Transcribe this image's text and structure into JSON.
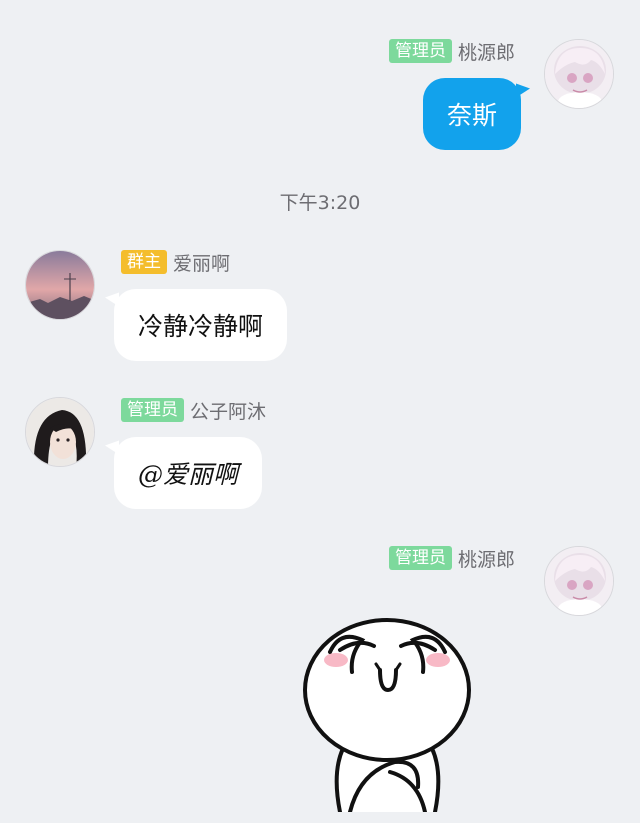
{
  "colors": {
    "background": "#eef0f3",
    "outgoing_bubble": "#12a2ec",
    "incoming_bubble": "#ffffff",
    "admin_badge": "#7dd99c",
    "owner_badge": "#f4bd2c"
  },
  "messages": [
    {
      "direction": "outgoing",
      "badge": "管理员",
      "sender": "桃源郎",
      "text": "奈斯",
      "avatar_icon": "anime-girl-avatar-icon"
    },
    {
      "direction": "incoming",
      "badge": "群主",
      "sender": "爱丽啊",
      "text": "冷静冷静啊",
      "avatar_icon": "sunset-avatar-icon"
    },
    {
      "direction": "incoming",
      "badge": "管理员",
      "sender": "公子阿沐",
      "text": "@爱丽啊",
      "avatar_icon": "dark-haired-avatar-icon"
    },
    {
      "direction": "outgoing",
      "badge": "管理员",
      "sender": "桃源郎",
      "sticker": "happy-cheering-sticker",
      "avatar_icon": "anime-girl-avatar-icon"
    }
  ],
  "timestamp": "下午3:20"
}
